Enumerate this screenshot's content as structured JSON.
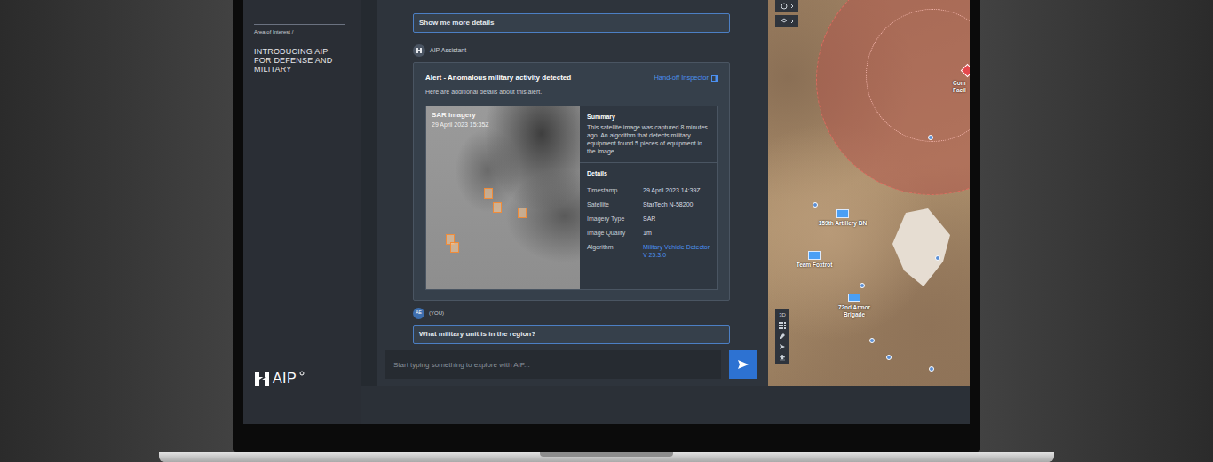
{
  "sidebar": {
    "breadcrumb": "Area of Interest /",
    "title": "INTRODUCING AIP FOR DEFENSE AND MILITARY",
    "logo": "AIP"
  },
  "chat": {
    "prompt": "Show me more details",
    "assistant": {
      "name": "AIP Assistant"
    },
    "alert": {
      "title": "Alert - Anomalous military activity detected",
      "link": "Hand-off Inspector",
      "subtitle": "Here are additional details about this alert.",
      "image": {
        "title": "SAR Imagery",
        "date": "29 April 2023 15:35Z"
      },
      "summary": {
        "title": "Summary",
        "text": "This satellite image was captured 8 minutes ago. An algorithm that detects military equipment found 5 pieces of equipment in the image."
      },
      "details": {
        "title": "Details",
        "rows": [
          {
            "label": "Timestamp",
            "value": "29 April 2023 14:39Z",
            "kind": "text"
          },
          {
            "label": "Satellite",
            "value": "StarTech N-58200",
            "kind": "text"
          },
          {
            "label": "Imagery Type",
            "value": "SAR",
            "kind": "text"
          },
          {
            "label": "Image Quality",
            "value": "1m",
            "kind": "text"
          },
          {
            "label": "Algorithm",
            "value": "Military Vehicle Detector V 25.3.0",
            "kind": "link"
          }
        ]
      }
    },
    "user": {
      "initials": "AE",
      "label": "(YOU)",
      "text": "What military unit is in the region?"
    },
    "composer": {
      "placeholder": "Start typing something to explore with AIP..."
    }
  },
  "map": {
    "facility": [
      "Com",
      "Facil"
    ],
    "units": [
      {
        "label": "159th Artillery BN"
      },
      {
        "label": "Team Foxtrot"
      },
      {
        "label": "72nd Armor Brigade"
      }
    ],
    "toolbar": [
      "3D"
    ]
  }
}
